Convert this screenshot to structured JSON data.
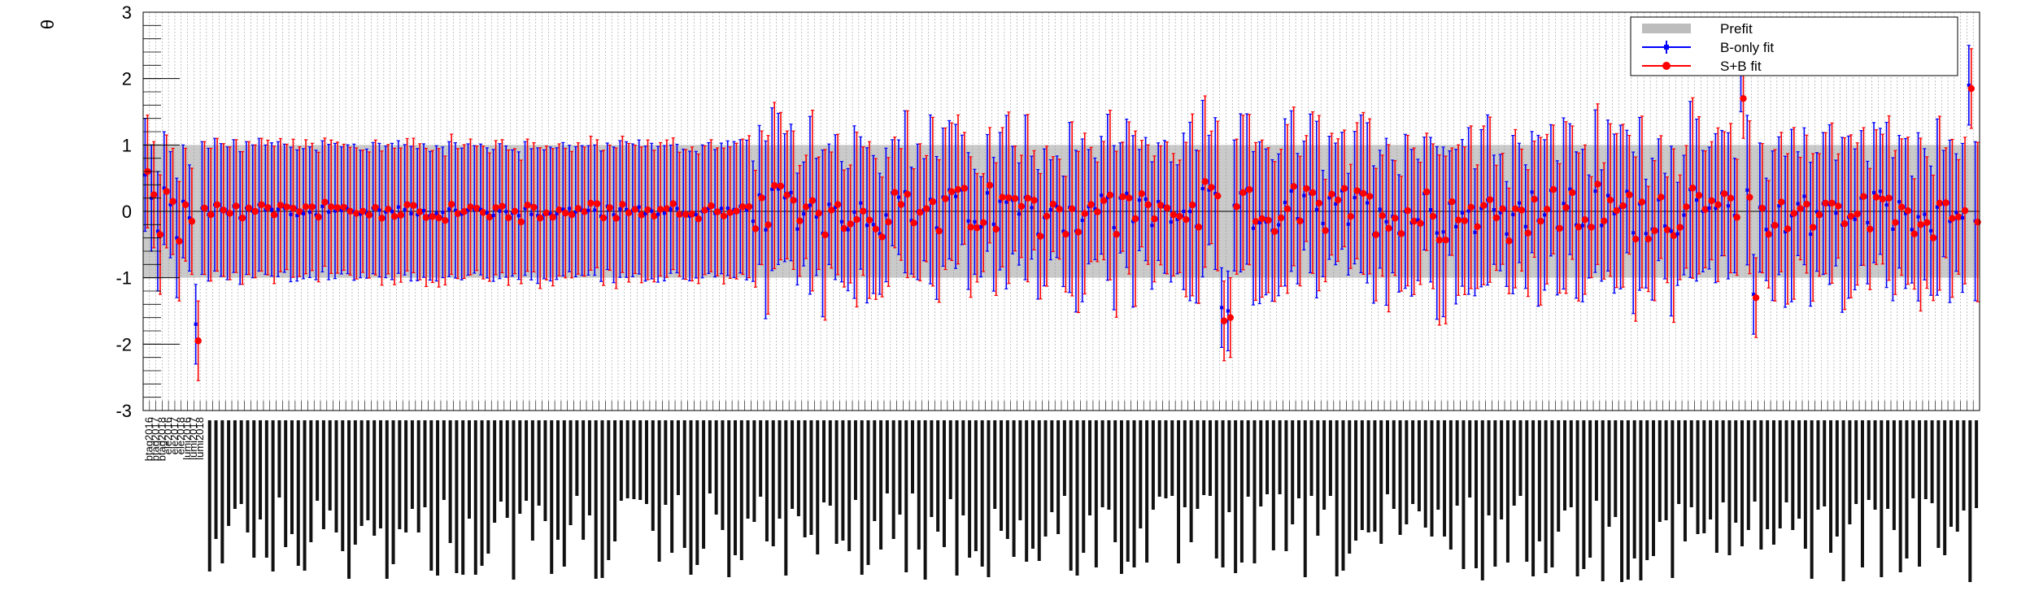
{
  "chart_data": {
    "type": "scatter",
    "title": "",
    "ylabel": "θ",
    "xlabel": "",
    "ylim": [
      -3,
      3
    ],
    "y_ticks": [
      -3,
      -2,
      -1,
      0,
      1,
      2,
      3
    ],
    "grid": true,
    "legend_position": "top-right",
    "n_parameters": 290,
    "legend": [
      {
        "label": "Prefit",
        "color": "#bdbdbd",
        "marker": "band"
      },
      {
        "label": "B-only fit",
        "color": "#0000ff",
        "marker": "errorbar"
      },
      {
        "label": "S+B fit",
        "color": "#ff0000",
        "marker": "circle"
      }
    ],
    "parameter_labels_visible": [
      {
        "index": 1,
        "label": "btag2016"
      },
      {
        "index": 2,
        "label": "btag2017"
      },
      {
        "index": 3,
        "label": "btag2018"
      },
      {
        "index": 4,
        "label": "ele2016"
      },
      {
        "index": 5,
        "label": "ele2017"
      },
      {
        "index": 6,
        "label": "ele2018"
      },
      {
        "index": 7,
        "label": "lumi2016"
      },
      {
        "index": 8,
        "label": "lumi2017"
      },
      {
        "index": 9,
        "label": "lumi2018"
      }
    ],
    "series": [
      {
        "name": "Prefit",
        "description": "±1σ band around 0",
        "color": "#bdbdbd",
        "central": 0,
        "uncertainty": 1
      },
      {
        "name": "B-only fit",
        "color": "#0000ff",
        "values": [
          0.55,
          0.2,
          -0.3,
          0.35,
          0.1,
          -0.4,
          0.15,
          -0.1,
          -1.7,
          0.05,
          -0.05,
          0.1,
          0.02,
          -0.03,
          0.08,
          -0.1,
          0.05,
          0.0,
          0.1
        ],
        "errors": [
          0.85,
          0.8,
          0.9,
          0.85,
          0.8,
          0.9,
          0.85,
          0.8,
          0.5,
          1.0,
          1.0,
          1.0,
          1.0,
          1.0,
          1.0,
          1.0,
          1.0,
          1.0,
          1.0
        ]
      },
      {
        "name": "S+B fit",
        "color": "#ff0000",
        "values": [
          0.6,
          0.25,
          -0.35,
          0.3,
          0.15,
          -0.45,
          0.1,
          -0.15,
          -1.95,
          0.05,
          -0.05,
          0.1,
          0.02,
          -0.03,
          0.08,
          -0.1,
          0.05,
          0.0,
          0.1
        ],
        "errors": [
          0.85,
          0.8,
          0.9,
          0.85,
          0.8,
          0.9,
          0.85,
          0.8,
          0.5,
          1.0,
          1.0,
          1.0,
          1.0,
          1.0,
          1.0,
          1.0,
          1.0,
          1.0,
          1.0
        ]
      }
    ],
    "highlighted_points": [
      {
        "index": 8,
        "bonly": -1.7,
        "splusb": -1.95
      },
      {
        "index": 170,
        "bonly": -1.45,
        "splusb": -1.65
      },
      {
        "index": 171,
        "bonly": -1.5,
        "splusb": -1.6
      },
      {
        "index": 252,
        "bonly": 2.1,
        "splusb": 1.7
      },
      {
        "index": 254,
        "bonly": -1.25,
        "splusb": -1.3
      },
      {
        "index": 288,
        "bonly": 1.9,
        "splusb": 1.85
      }
    ]
  }
}
